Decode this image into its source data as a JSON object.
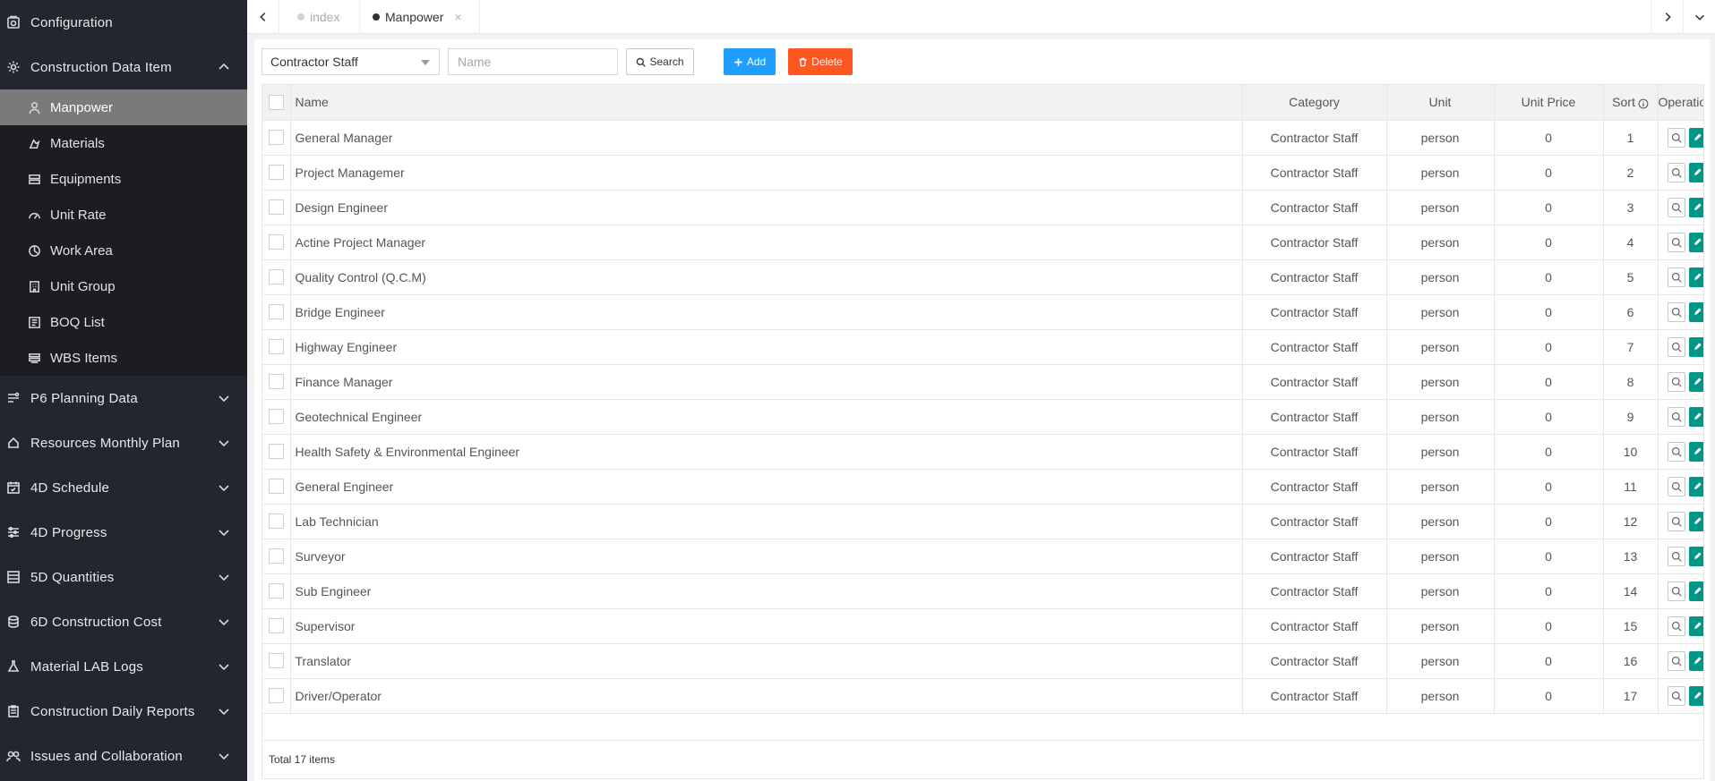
{
  "sidebar": {
    "top": [
      {
        "label": "Configuration",
        "icon": "gear-box-icon"
      },
      {
        "label": "Construction Data Item",
        "icon": "gear-icon",
        "expanded": true
      }
    ],
    "sub_items": [
      {
        "label": "Manpower",
        "icon": "person-icon",
        "active": true
      },
      {
        "label": "Materials",
        "icon": "materials-icon"
      },
      {
        "label": "Equipments",
        "icon": "equipment-icon"
      },
      {
        "label": "Unit Rate",
        "icon": "gauge-icon"
      },
      {
        "label": "Work Area",
        "icon": "area-icon"
      },
      {
        "label": "Unit Group",
        "icon": "building-icon"
      },
      {
        "label": "BOQ List",
        "icon": "list-icon"
      },
      {
        "label": "WBS Items",
        "icon": "wbs-icon"
      }
    ],
    "bottom": [
      {
        "label": "P6 Planning Data",
        "icon": "planning-icon"
      },
      {
        "label": "Resources Monthly Plan",
        "icon": "resources-icon"
      },
      {
        "label": "4D Schedule",
        "icon": "calendar-icon"
      },
      {
        "label": "4D Progress",
        "icon": "sliders-icon"
      },
      {
        "label": "5D Quantities",
        "icon": "quantities-icon"
      },
      {
        "label": "6D Construction Cost",
        "icon": "coins-icon"
      },
      {
        "label": "Material LAB Logs",
        "icon": "flask-icon"
      },
      {
        "label": "Construction Daily Reports",
        "icon": "clipboard-icon"
      },
      {
        "label": "Issues and Collaboration",
        "icon": "collab-icon"
      }
    ]
  },
  "tabs": [
    {
      "label": "index",
      "active": false
    },
    {
      "label": "Manpower",
      "active": true
    }
  ],
  "toolbar": {
    "category_selected": "Contractor Staff",
    "name_placeholder": "Name",
    "search_label": "Search",
    "add_label": "Add",
    "delete_label": "Delete"
  },
  "table": {
    "headers": {
      "name": "Name",
      "category": "Category",
      "unit": "Unit",
      "unit_price": "Unit Price",
      "sort": "Sort",
      "operation": "Operation"
    },
    "rows": [
      {
        "name": "General Manager",
        "category": "Contractor Staff",
        "unit": "person",
        "unit_price": "0",
        "sort": "1"
      },
      {
        "name": "Project Managemer",
        "category": "Contractor Staff",
        "unit": "person",
        "unit_price": "0",
        "sort": "2"
      },
      {
        "name": "Design Engineer",
        "category": "Contractor Staff",
        "unit": "person",
        "unit_price": "0",
        "sort": "3"
      },
      {
        "name": "Actine Project Manager",
        "category": "Contractor Staff",
        "unit": "person",
        "unit_price": "0",
        "sort": "4"
      },
      {
        "name": "Quality Control (Q.C.M)",
        "category": "Contractor Staff",
        "unit": "person",
        "unit_price": "0",
        "sort": "5"
      },
      {
        "name": "Bridge Engineer",
        "category": "Contractor Staff",
        "unit": "person",
        "unit_price": "0",
        "sort": "6"
      },
      {
        "name": "Highway Engineer",
        "category": "Contractor Staff",
        "unit": "person",
        "unit_price": "0",
        "sort": "7"
      },
      {
        "name": "Finance Manager",
        "category": "Contractor Staff",
        "unit": "person",
        "unit_price": "0",
        "sort": "8"
      },
      {
        "name": "Geotechnical Engineer",
        "category": "Contractor Staff",
        "unit": "person",
        "unit_price": "0",
        "sort": "9"
      },
      {
        "name": "Health Safety & Environmental Engineer",
        "category": "Contractor Staff",
        "unit": "person",
        "unit_price": "0",
        "sort": "10"
      },
      {
        "name": "General Engineer",
        "category": "Contractor Staff",
        "unit": "person",
        "unit_price": "0",
        "sort": "11"
      },
      {
        "name": "Lab Technician",
        "category": "Contractor Staff",
        "unit": "person",
        "unit_price": "0",
        "sort": "12"
      },
      {
        "name": "Surveyor",
        "category": "Contractor Staff",
        "unit": "person",
        "unit_price": "0",
        "sort": "13"
      },
      {
        "name": "Sub Engineer",
        "category": "Contractor Staff",
        "unit": "person",
        "unit_price": "0",
        "sort": "14"
      },
      {
        "name": "Supervisor",
        "category": "Contractor Staff",
        "unit": "person",
        "unit_price": "0",
        "sort": "15"
      },
      {
        "name": "Translator",
        "category": "Contractor Staff",
        "unit": "person",
        "unit_price": "0",
        "sort": "16"
      },
      {
        "name": "Driver/Operator",
        "category": "Contractor Staff",
        "unit": "person",
        "unit_price": "0",
        "sort": "17"
      }
    ],
    "total_text": "Total 17 items"
  },
  "colors": {
    "sidebar_bg": "#23262e",
    "active_item": "#7a7a7a",
    "add": "#1e9fff",
    "delete": "#ff5722",
    "edit": "#009688"
  }
}
